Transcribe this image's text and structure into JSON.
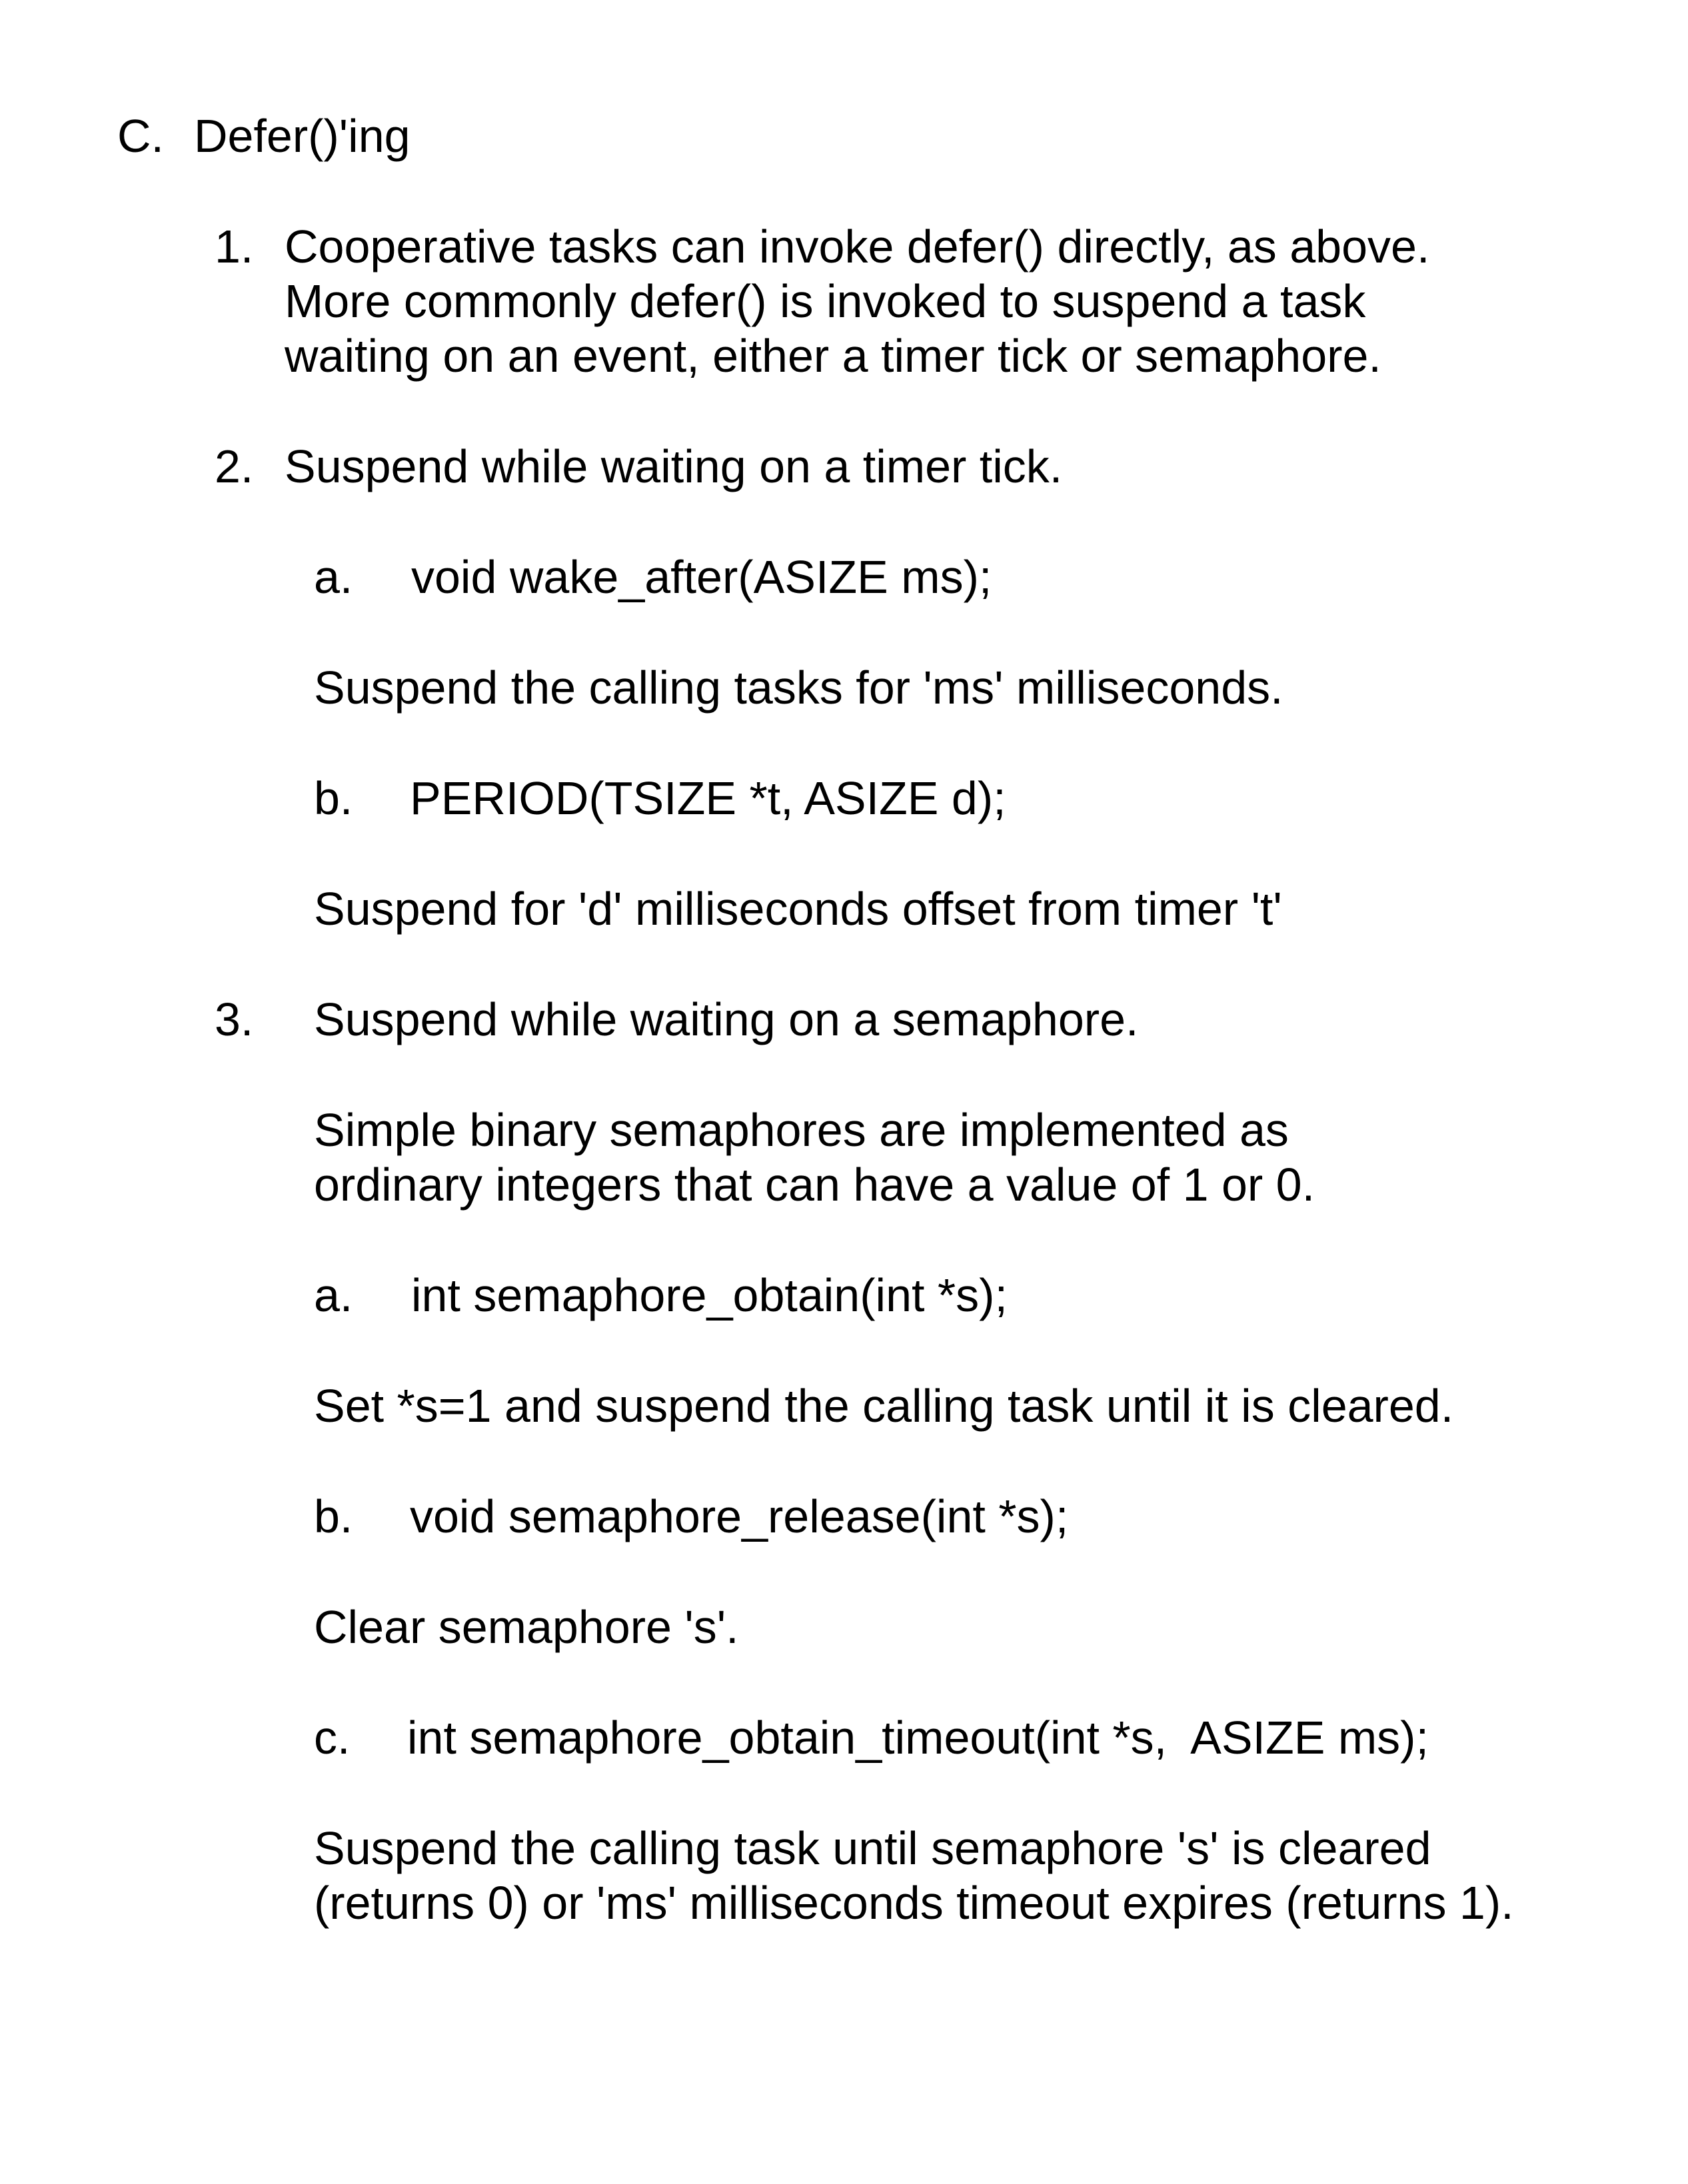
{
  "heading": {
    "marker": "C.",
    "text": "Defer()'ing"
  },
  "item1": {
    "marker": "1.",
    "lines": [
      "Cooperative tasks can invoke defer() directly, as above.",
      "More commonly defer() is invoked to suspend a task",
      "waiting on an event, either a timer tick or semaphore."
    ]
  },
  "item2": {
    "marker": "2.",
    "text": "Suspend while waiting on a timer tick.",
    "a": {
      "marker": "a.",
      "code": "void wake_after(ASIZE ms);",
      "desc": "Suspend the calling tasks for 'ms' milliseconds."
    },
    "b": {
      "marker": "b.",
      "code": "PERIOD(TSIZE *t, ASIZE d);",
      "desc": "Suspend for 'd' milliseconds offset from timer 't'"
    }
  },
  "item3": {
    "marker": "3.",
    "text": "Suspend while waiting on a semaphore.",
    "intro": [
      "Simple binary semaphores are implemented as",
      "ordinary integers that can have a value of 1 or 0."
    ],
    "a": {
      "marker": "a.",
      "code": "int semaphore_obtain(int *s);",
      "desc": "Set *s=1 and suspend the calling task until it is cleared."
    },
    "b": {
      "marker": "b.",
      "code": "void semaphore_release(int *s);",
      "desc": "Clear semaphore 's'."
    },
    "c": {
      "marker": "c.",
      "code": "int semaphore_obtain_timeout(int *s,  ASIZE ms);",
      "desc": [
        "Suspend the calling task until semaphore 's' is cleared",
        "(returns 0) or 'ms' milliseconds timeout expires (returns 1)."
      ]
    }
  }
}
